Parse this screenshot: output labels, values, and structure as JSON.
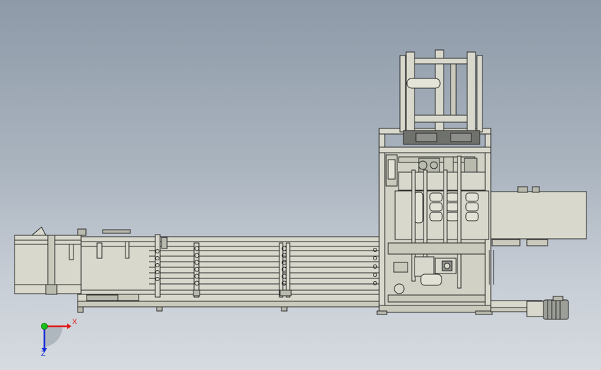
{
  "triad": {
    "x_label": "X",
    "z_label": "Z",
    "colors": {
      "x": "#e01818",
      "y": "#19c019",
      "z": "#1b2fd8"
    }
  },
  "colors": {
    "background_top": "#8e9aa8",
    "background_bottom": "#d6dbe0",
    "machine_body": "#d8d8cc",
    "machine_shadow": "#b9baae",
    "line": "#262626",
    "motor_dark": "#8d8f8a"
  }
}
